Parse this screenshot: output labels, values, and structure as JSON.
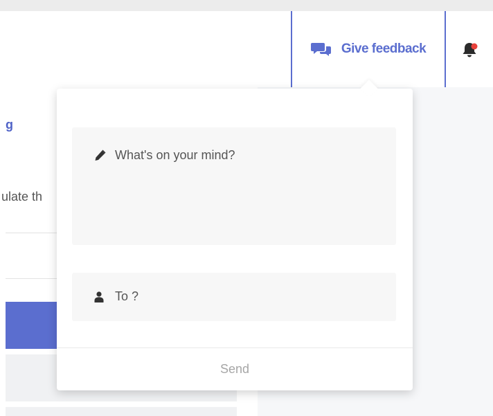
{
  "header": {
    "feedback_button": {
      "label": "Give feedback",
      "icon": "comments-icon",
      "color": "#5b6ecf"
    },
    "notification": {
      "icon": "bell-icon",
      "badge_color": "#e8413b"
    }
  },
  "background": {
    "heading": "g",
    "description": "ulate th"
  },
  "popup": {
    "mind_field": {
      "icon": "pencil-icon",
      "placeholder": "What's on your mind?"
    },
    "to_field": {
      "icon": "user-icon",
      "placeholder": "To ?"
    },
    "send_label": "Send"
  }
}
